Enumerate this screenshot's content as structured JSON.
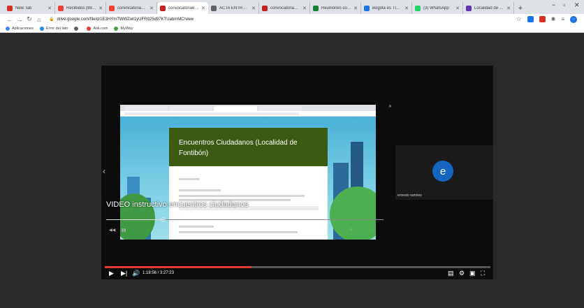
{
  "tabs": [
    {
      "title": "New Tab",
      "color": "#d93025",
      "active": false
    },
    {
      "title": "Recibidos (896) - ▪",
      "color": "#ea4335",
      "active": false
    },
    {
      "title": "convocatoriaesecio",
      "color": "#ea4335",
      "active": false
    },
    {
      "title": "convocatoriaesecio",
      "color": "#c5221f",
      "active": true
    },
    {
      "title": "ACTA ENTREGA VT",
      "color": "#5f6368",
      "active": false
    },
    {
      "title": "convocatoriaesecio",
      "color": "#c5221f",
      "active": false
    },
    {
      "title": "Reuniones con Alc",
      "color": "#188038",
      "active": false
    },
    {
      "title": "Bogotá es TIC - Co",
      "color": "#1a73e8",
      "active": false
    },
    {
      "title": "(3) WhatsApp",
      "color": "#25d366",
      "active": false
    },
    {
      "title": "Localidad de Fonti",
      "color": "#5e35b1",
      "active": false
    }
  ],
  "toolbar": {
    "url": "drive.google.com/file/d/1E3HYmTWWZwt1yUFR925d97KTUabmMC/view"
  },
  "bookmarks": [
    {
      "label": "Aplicaciones",
      "color": "#4285f4"
    },
    {
      "label": "Error del lato",
      "color": "#1e88e5"
    },
    {
      "label": "",
      "color": "#5f6368"
    },
    {
      "label": "Ask.com",
      "color": "#e53935"
    },
    {
      "label": "MyWay",
      "color": "#43a047"
    }
  ],
  "recording": {
    "form_title": "Encuentros Ciudadanos (Localidad de Fontibón)",
    "video_title": "VIDEO instructivo encuentros ciudadanos",
    "progress_fraction": 0.21
  },
  "participant": {
    "initial": "e",
    "name": "ernesto ramirez"
  },
  "player": {
    "time": "1:18:56 / 3:27:23",
    "progress_fraction": 0.38
  }
}
